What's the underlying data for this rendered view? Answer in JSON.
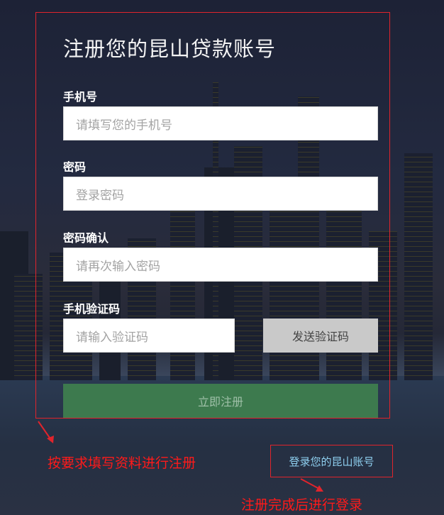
{
  "form": {
    "title": "注册您的昆山贷款账号",
    "phone_label": "手机号",
    "phone_placeholder": "请填写您的手机号",
    "password_label": "密码",
    "password_placeholder": "登录密码",
    "confirm_label": "密码确认",
    "confirm_placeholder": "请再次输入密码",
    "code_label": "手机验证码",
    "code_placeholder": "请输入验证码",
    "send_code_label": "发送验证码",
    "submit_label": "立即注册"
  },
  "login_link": "登录您的昆山账号",
  "annotations": {
    "fill_hint": "按要求填写资料进行注册",
    "login_hint": "注册完成后进行登录"
  },
  "colors": {
    "annotation_red": "#e0242c",
    "submit_green": "#3d7a4e",
    "link_blue": "#8fd0f0"
  }
}
